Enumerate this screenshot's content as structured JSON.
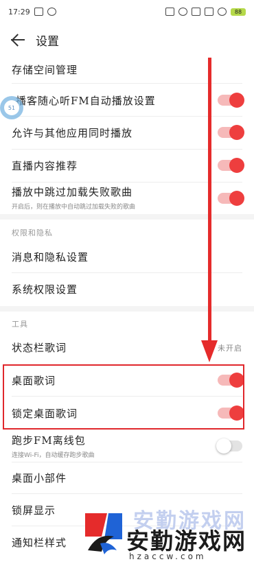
{
  "status_bar": {
    "time": "17:29",
    "battery": "88"
  },
  "header": {
    "title": "设置"
  },
  "rows": {
    "storage": {
      "label": "存储空间管理"
    },
    "fm_autoplay": {
      "label": "播客随心听FM自动播放设置",
      "toggle": true
    },
    "mix_play": {
      "label": "允许与其他应用同时播放",
      "toggle": true
    },
    "live_recommend": {
      "label": "直播内容推荐",
      "toggle": true
    },
    "skip_failed": {
      "label": "播放中跳过加载失败歌曲",
      "sub": "开启后，则在播放中自动跳过加载失败的歌曲",
      "toggle": true
    },
    "message_privacy": {
      "label": "消息和隐私设置"
    },
    "system_permission": {
      "label": "系统权限设置"
    },
    "statusbar_lyrics": {
      "label": "状态栏歌词",
      "value": "未开启"
    },
    "desktop_lyrics": {
      "label": "桌面歌词",
      "toggle": true
    },
    "lock_desktop_lyrics": {
      "label": "锁定桌面歌词",
      "toggle": true
    },
    "run_fm_offline": {
      "label": "跑步FM离线包",
      "sub": "连接Wi-Fi，自动缓存跑步歌曲",
      "toggle": false
    },
    "desktop_widget": {
      "label": "桌面小部件"
    },
    "lockscreen": {
      "label": "锁屏显示"
    },
    "notification_style": {
      "label": "通知栏样式"
    }
  },
  "sections": {
    "privacy": "权限和隐私",
    "tools": "工具"
  },
  "floating_bubble": {
    "text": "51"
  },
  "watermark": {
    "main": "安勤游戏网",
    "domain": "hzaccw.com"
  },
  "colors": {
    "accent": "#ee3e3e",
    "annotation": "#e52b2b"
  }
}
